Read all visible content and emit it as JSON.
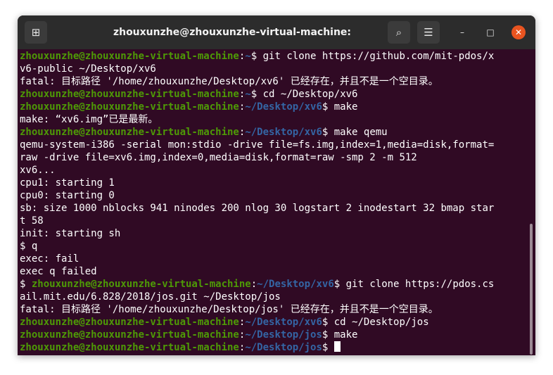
{
  "window": {
    "title": "zhouxunzhe@zhouxunzhe-virtual-machine: ~/Desktop/jos",
    "buttons": {
      "new_tab": "⊞",
      "search": "⌕",
      "menu": "☰",
      "minimize": "–",
      "maximize": "□",
      "close": "✕"
    }
  },
  "colors": {
    "background": "#300a24",
    "user_host": "#4e9a06",
    "path": "#3465a4",
    "text": "#ffffff",
    "close": "#e95420"
  },
  "terminal": {
    "lines": [
      {
        "user": "zhouxunzhe@zhouxunzhe-virtual-machine",
        "sep": ":",
        "path": "~",
        "prompt": "$",
        "cmd": " git clone https://github.com/mit-pdos/x"
      },
      {
        "text": "v6-public ~/Desktop/xv6"
      },
      {
        "text": "fatal: 目标路径 '/home/zhouxunzhe/Desktop/xv6' 已经存在，并且不是一个空目录。"
      },
      {
        "user": "zhouxunzhe@zhouxunzhe-virtual-machine",
        "sep": ":",
        "path": "~",
        "prompt": "$",
        "cmd": " cd ~/Desktop/xv6"
      },
      {
        "user": "zhouxunzhe@zhouxunzhe-virtual-machine",
        "sep": ":",
        "path": "~/Desktop/xv6",
        "prompt": "$",
        "cmd": " make"
      },
      {
        "text": "make: “xv6.img”已是最新。"
      },
      {
        "user": "zhouxunzhe@zhouxunzhe-virtual-machine",
        "sep": ":",
        "path": "~/Desktop/xv6",
        "prompt": "$",
        "cmd": " make qemu"
      },
      {
        "text": "qemu-system-i386 -serial mon:stdio -drive file=fs.img,index=1,media=disk,format="
      },
      {
        "text": "raw -drive file=xv6.img,index=0,media=disk,format=raw -smp 2 -m 512"
      },
      {
        "text": "xv6..."
      },
      {
        "text": "cpu1: starting 1"
      },
      {
        "text": "cpu0: starting 0"
      },
      {
        "text": "sb: size 1000 nblocks 941 ninodes 200 nlog 30 logstart 2 inodestart 32 bmap star"
      },
      {
        "text": "t 58"
      },
      {
        "text": "init: starting sh"
      },
      {
        "text": "$ q"
      },
      {
        "text": "exec: fail"
      },
      {
        "text": "exec q failed"
      },
      {
        "lead": "$ ",
        "user": "zhouxunzhe@zhouxunzhe-virtual-machine",
        "sep": ":",
        "path": "~/Desktop/xv6",
        "prompt": "$",
        "cmd": " git clone https://pdos.cs"
      },
      {
        "text": "ail.mit.edu/6.828/2018/jos.git ~/Desktop/jos"
      },
      {
        "text": "fatal: 目标路径 '/home/zhouxunzhe/Desktop/jos' 已经存在，并且不是一个空目录。"
      },
      {
        "user": "zhouxunzhe@zhouxunzhe-virtual-machine",
        "sep": ":",
        "path": "~/Desktop/xv6",
        "prompt": "$",
        "cmd": " cd ~/Desktop/jos"
      },
      {
        "user": "zhouxunzhe@zhouxunzhe-virtual-machine",
        "sep": ":",
        "path": "~/Desktop/jos",
        "prompt": "$",
        "cmd": " make"
      },
      {
        "user": "zhouxunzhe@zhouxunzhe-virtual-machine",
        "sep": ":",
        "path": "~/Desktop/jos",
        "prompt": "$",
        "cmd": " ",
        "cursor": true
      }
    ]
  }
}
